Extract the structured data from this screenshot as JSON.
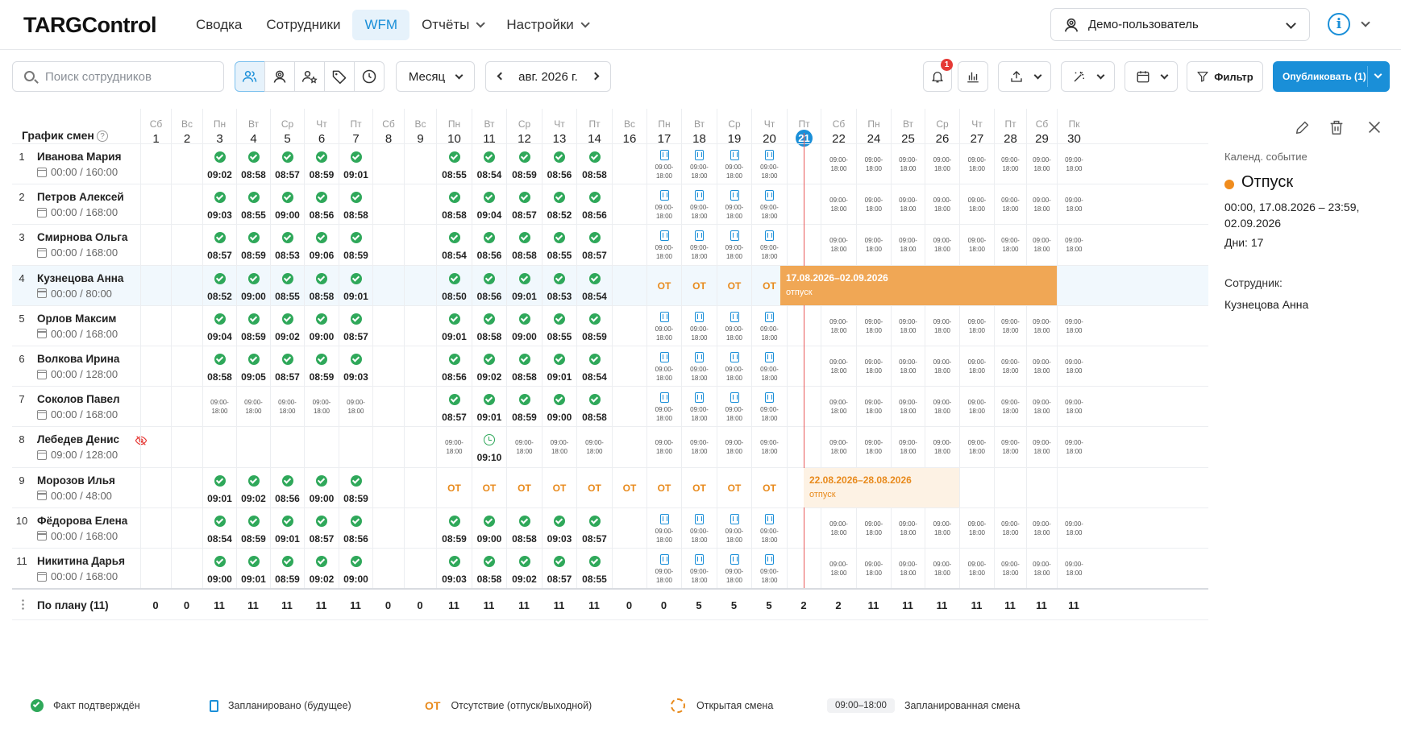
{
  "app": {
    "logo": "TARGControl"
  },
  "nav": [
    {
      "label": "Сводка",
      "active": false,
      "dropdown": false
    },
    {
      "label": "Сотрудники",
      "active": false,
      "dropdown": false
    },
    {
      "label": "WFM",
      "active": true,
      "dropdown": false
    },
    {
      "label": "Отчёты",
      "active": false,
      "dropdown": true
    },
    {
      "label": "Настройки",
      "active": false,
      "dropdown": true
    }
  ],
  "user": {
    "name": "Демо-пользователь"
  },
  "toolbar": {
    "search_placeholder": "Поиск сотрудников",
    "period": "Месяц",
    "month": "авг. 2026 г.",
    "notifications_count": "1",
    "filter": "Фильтр",
    "publish": "Опубликовать (1)"
  },
  "grid": {
    "title": "График смен",
    "today": 21,
    "days": [
      {
        "dw": "Сб",
        "d": 1
      },
      {
        "dw": "Вс",
        "d": 2
      },
      {
        "dw": "Пн",
        "d": 3
      },
      {
        "dw": "Вт",
        "d": 4
      },
      {
        "dw": "Ср",
        "d": 5
      },
      {
        "dw": "Чт",
        "d": 6
      },
      {
        "dw": "Пт",
        "d": 7
      },
      {
        "dw": "Сб",
        "d": 8
      },
      {
        "dw": "Вс",
        "d": 9
      },
      {
        "dw": "Пн",
        "d": 10
      },
      {
        "dw": "Вт",
        "d": 11
      },
      {
        "dw": "Ср",
        "d": 12
      },
      {
        "dw": "Чт",
        "d": 13
      },
      {
        "dw": "Пт",
        "d": 14
      },
      {
        "dw": "Вс",
        "d": 16
      },
      {
        "dw": "Пн",
        "d": 17
      },
      {
        "dw": "Вт",
        "d": 18
      },
      {
        "dw": "Ср",
        "d": 19
      },
      {
        "dw": "Чт",
        "d": 20
      },
      {
        "dw": "Пт",
        "d": 21
      },
      {
        "dw": "Сб",
        "d": 22
      },
      {
        "dw": "Пн",
        "d": 24
      },
      {
        "dw": "Вт",
        "d": 25
      },
      {
        "dw": "Ср",
        "d": 26
      },
      {
        "dw": "Чт",
        "d": 27
      },
      {
        "dw": "Пт",
        "d": 28
      },
      {
        "dw": "Сб",
        "d": 29
      },
      {
        "dw": "Пк",
        "d": 30
      }
    ],
    "planned_shift": "09:00-\n18:00",
    "absence_label": "ОТ",
    "employees": [
      {
        "n": 1,
        "name": "Иванова Мария",
        "hours": "00:00 / 160:00",
        "cells": [
          "",
          "",
          "c:09:02",
          "c:08:58",
          "c:08:57",
          "c:08:59",
          "c:09:01",
          "",
          "",
          "c:08:55",
          "c:08:54",
          "c:08:59",
          "c:08:56",
          "c:08:58",
          "",
          "h",
          "h",
          "h",
          "h",
          "",
          "p",
          "p",
          "p",
          "p",
          "p",
          "p",
          "p",
          "p"
        ]
      },
      {
        "n": 2,
        "name": "Петров Алексей",
        "hours": "00:00 / 168:00",
        "cells": [
          "",
          "",
          "c:09:03",
          "c:08:55",
          "c:09:00",
          "c:08:56",
          "c:08:58",
          "",
          "",
          "c:08:58",
          "c:09:04",
          "c:08:57",
          "c:08:52",
          "c:08:56",
          "",
          "h",
          "h",
          "h",
          "h",
          "",
          "p",
          "p",
          "p",
          "p",
          "p",
          "p",
          "p",
          "p"
        ]
      },
      {
        "n": 3,
        "name": "Смирнова Ольга",
        "hours": "00:00 / 168:00",
        "cells": [
          "",
          "",
          "c:08:57",
          "c:08:59",
          "c:08:53",
          "c:09:06",
          "c:08:59",
          "",
          "",
          "c:08:54",
          "c:08:56",
          "c:08:58",
          "c:08:55",
          "c:08:57",
          "",
          "h",
          "h",
          "h",
          "h",
          "",
          "p",
          "p",
          "p",
          "p",
          "p",
          "p",
          "p",
          "p"
        ]
      },
      {
        "n": 4,
        "name": "Кузнецова Анна",
        "hours": "00:00 / 80:00",
        "selected": true,
        "cells": [
          "",
          "",
          "c:08:52",
          "c:09:00",
          "c:08:55",
          "c:08:58",
          "c:09:01",
          "",
          "",
          "c:08:50",
          "c:08:56",
          "c:09:01",
          "c:08:53",
          "c:08:54",
          "",
          "o",
          "o",
          "o",
          "o",
          "",
          "",
          "",
          "",
          "",
          "",
          "",
          "",
          ""
        ]
      },
      {
        "n": 5,
        "name": "Орлов Максим",
        "hours": "00:00 / 168:00",
        "cells": [
          "",
          "",
          "c:09:04",
          "c:08:59",
          "c:09:02",
          "c:09:00",
          "c:08:57",
          "",
          "",
          "c:09:01",
          "c:08:58",
          "c:09:00",
          "c:08:55",
          "c:08:59",
          "",
          "h",
          "h",
          "h",
          "h",
          "",
          "p",
          "p",
          "p",
          "p",
          "p",
          "p",
          "p",
          "p"
        ]
      },
      {
        "n": 6,
        "name": "Волкова Ирина",
        "hours": "00:00 / 128:00",
        "cells": [
          "",
          "",
          "c:08:58",
          "c:09:05",
          "c:08:57",
          "c:08:59",
          "c:09:03",
          "",
          "",
          "c:08:56",
          "c:09:02",
          "c:08:58",
          "c:09:01",
          "c:08:54",
          "",
          "h",
          "h",
          "h",
          "h",
          "",
          "p",
          "p",
          "p",
          "p",
          "p",
          "p",
          "p",
          "p"
        ]
      },
      {
        "n": 7,
        "name": "Соколов Павел",
        "hours": "00:00 / 168:00",
        "cells": [
          "",
          "",
          "p",
          "p",
          "p",
          "p",
          "p",
          "",
          "",
          "c:08:57",
          "c:09:01",
          "c:08:59",
          "c:09:00",
          "c:08:58",
          "",
          "h",
          "h",
          "h",
          "h",
          "",
          "p",
          "p",
          "p",
          "p",
          "p",
          "p",
          "p",
          "p"
        ]
      },
      {
        "n": 8,
        "name": "Лебедев Денис",
        "hours": "09:00 / 128:00",
        "hidden": true,
        "cells": [
          "",
          "",
          "",
          "",
          "",
          "",
          "",
          "",
          "",
          "pc",
          "k:09:10",
          "pc",
          "pc",
          "pc",
          "",
          "pc",
          "pc",
          "pc",
          "pc",
          "",
          "p",
          "p",
          "p",
          "p",
          "p",
          "p",
          "p",
          "p"
        ]
      },
      {
        "n": 9,
        "name": "Морозов Илья",
        "hours": "00:00 / 48:00",
        "cells": [
          "",
          "",
          "c:09:01",
          "c:09:02",
          "c:08:56",
          "c:09:00",
          "c:08:59",
          "",
          "",
          "o",
          "o",
          "o",
          "o",
          "o",
          "o",
          "o",
          "o",
          "o",
          "o",
          "",
          "",
          "",
          "",
          "",
          "",
          "",
          "",
          ""
        ]
      },
      {
        "n": 10,
        "name": "Фёдорова Елена",
        "hours": "00:00 / 168:00",
        "cells": [
          "",
          "",
          "c:08:54",
          "c:08:59",
          "c:09:01",
          "c:08:57",
          "c:08:56",
          "",
          "",
          "c:08:59",
          "c:09:00",
          "c:08:58",
          "c:09:03",
          "c:08:57",
          "",
          "h",
          "h",
          "h",
          "h",
          "",
          "p",
          "p",
          "p",
          "p",
          "p",
          "p",
          "p",
          "p"
        ]
      },
      {
        "n": 11,
        "name": "Никитина Дарья",
        "hours": "00:00 / 168:00",
        "cells": [
          "",
          "",
          "c:09:00",
          "c:09:01",
          "c:08:59",
          "c:09:02",
          "c:09:00",
          "",
          "",
          "c:09:03",
          "c:08:58",
          "c:09:02",
          "c:08:57",
          "c:08:55",
          "",
          "h",
          "h",
          "h",
          "h",
          "",
          "p",
          "p",
          "p",
          "p",
          "p",
          "p",
          "p",
          "p"
        ]
      }
    ],
    "vacations": [
      {
        "row": 3,
        "start": 19,
        "end": 27,
        "range": "17.08.2026–02.09.2026",
        "label": "отпуск",
        "style": "solid"
      },
      {
        "row": 8,
        "start": 19,
        "end": 24,
        "range": "22.08.2026–28.08.2026",
        "label": "отпуск",
        "style": "light"
      }
    ],
    "footer": {
      "label": "По плану (11)",
      "values": [
        "0",
        "0",
        "11",
        "11",
        "11",
        "11",
        "11",
        "0",
        "0",
        "11",
        "11",
        "11",
        "11",
        "11",
        "0",
        "0",
        "5",
        "5",
        "5",
        "2",
        "2",
        "11",
        "11",
        "11",
        "11",
        "11",
        "11",
        "11"
      ]
    }
  },
  "legend": [
    {
      "icon": "check",
      "label": "Факт подтверждён"
    },
    {
      "icon": "hourglass",
      "label": "Запланировано (будущее)"
    },
    {
      "icon": "ot",
      "sym": "ОТ",
      "label": "Отсутствие (отпуск/выходной)"
    },
    {
      "icon": "open",
      "label": "Открытая смена"
    },
    {
      "icon": "chip",
      "sym": "09:00–18:00",
      "label": "Запланированная смена"
    }
  ],
  "panel": {
    "subtitle": "Календ. событие",
    "title": "Отпуск",
    "range": "00:00, 17.08.2026 – 23:59, 02.09.2026",
    "days": "Дни: 17",
    "employee_label": "Сотрудник:",
    "employee": "Кузнецова Анна",
    "accent": "#f08c1d"
  }
}
